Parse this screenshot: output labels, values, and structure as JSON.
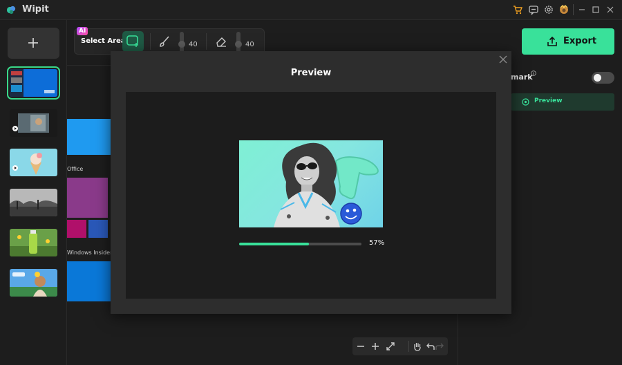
{
  "app": {
    "title": "Wipit"
  },
  "toolbar": {
    "ai_badge": "AI",
    "select_area_label": "Select Area",
    "brush_size": "40",
    "eraser_size": "40"
  },
  "canvas": {
    "tile_labels": [
      "Office",
      "Windows Insider"
    ]
  },
  "right_panel": {
    "export_label": "Export",
    "watermark_label": "mark",
    "info_symbol": "i",
    "preview_label": "Preview"
  },
  "modal": {
    "title": "Preview",
    "progress_percent": 57,
    "progress_text": "57%"
  },
  "colors": {
    "accent": "#39e19a",
    "background": "#1d1d1d",
    "modal_bg": "#2d2d2d"
  }
}
